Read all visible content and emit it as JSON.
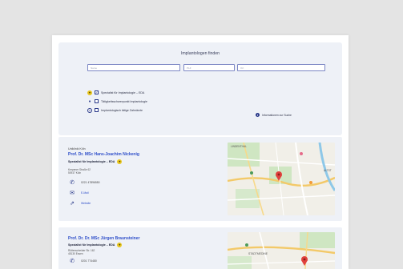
{
  "search": {
    "title": "Implantologen finden",
    "name_placeholder": "Name",
    "zip_placeholder": "PLZ",
    "city_placeholder": "Ort",
    "filters": [
      {
        "label": "Spezialist für Implantologie – EDA",
        "icon": "gold-badge-icon",
        "checked": true
      },
      {
        "label": "Tätigkeitsschwerpunkt Implantologie",
        "icon": "tooth-icon",
        "checked": false
      },
      {
        "label": "Implantologisch tätige Zahnärzte",
        "icon": "tooth-outline-icon",
        "checked": false
      }
    ],
    "info_label": "Informationen zur Suche"
  },
  "results": [
    {
      "practice": "Uniklinik Köln",
      "name": "Prof. Dr. MSc Hans-Joachim Nickenig",
      "specialty": "Spezialist für Implantologie – EDA",
      "address_line1": "Kerpener Straße 62",
      "address_line2": "50937 Köln",
      "phone": "0221 47896550",
      "email_label": "E-Mail",
      "website_label": "Website",
      "map_labels": [
        "LINDENTHAL",
        "ALTST"
      ]
    },
    {
      "practice": "",
      "name": "Prof. Dr. Dr. MSc Jürgen Braunsteiner",
      "specialty": "Spezialist für Implantologie – EDA",
      "address_line1": "Rüttenscheider Str. 162",
      "address_line2": "45130 Essen",
      "phone": "0201 774480",
      "map_labels": [
        "STADTMEDINE"
      ]
    }
  ],
  "colors": {
    "accent": "#2e4ec9",
    "navy": "#2a3a8a",
    "gold": "#e7c51d",
    "panel": "#eef1f7"
  }
}
